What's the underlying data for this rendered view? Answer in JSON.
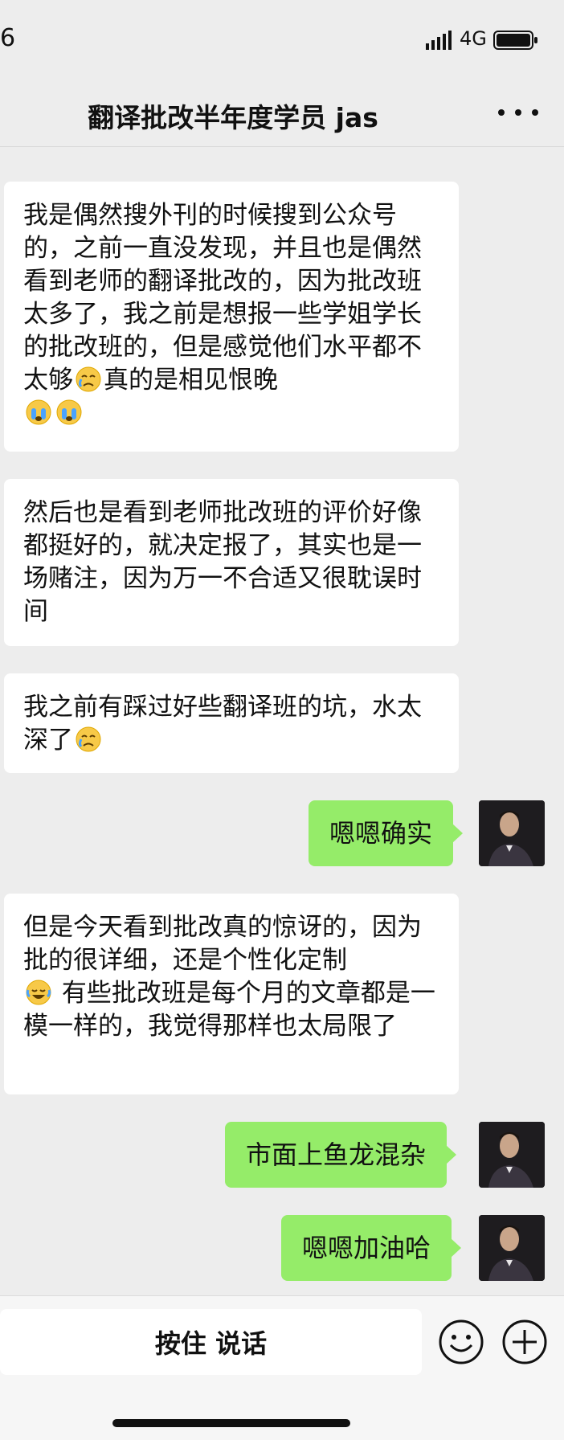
{
  "status_bar": {
    "time": "6",
    "network": "4G"
  },
  "nav": {
    "title": "翻译批改半年度学员 jas"
  },
  "messages": [
    {
      "side": "in",
      "text_lines": [
        "我是偶然搜外刊的时候搜到公众号的，之前一直没发现，并且也是偶然看到老师的翻译批改的，因为批改班太多了，我之前是想报一些学姐学长的批改班的，但是感觉他们水平都不太够",
        "真的是相见恨晚"
      ],
      "emojis": [
        "cry-emoji",
        "sob-emoji",
        "sob-emoji"
      ]
    },
    {
      "side": "in",
      "text": "然后也是看到老师批改班的评价好像都挺好的，就决定报了，其实也是一场赌注，因为万一不合适又很耽误时间"
    },
    {
      "side": "in",
      "text": "我之前有踩过好些翻译班的坑，水太深了",
      "emojis": [
        "cry-emoji"
      ]
    },
    {
      "side": "out",
      "text": "嗯嗯确实"
    },
    {
      "side": "in",
      "text_a": "但是今天看到批改真的惊讶的，因为批的很详细，还是个性化定制",
      "text_b": " 有些批改班是每个月的文章都是一模一样的，我觉得那样也太局限了",
      "emojis": [
        "tears-of-joy-emoji"
      ]
    },
    {
      "side": "out",
      "text": "市面上鱼龙混杂"
    },
    {
      "side": "out",
      "text": "嗯嗯加油哈"
    }
  ],
  "input_bar": {
    "hold_to_talk_label": "按住 说话"
  },
  "colors": {
    "background": "#ededed",
    "incoming_bubble": "#ffffff",
    "outgoing_bubble": "#95ec69"
  }
}
